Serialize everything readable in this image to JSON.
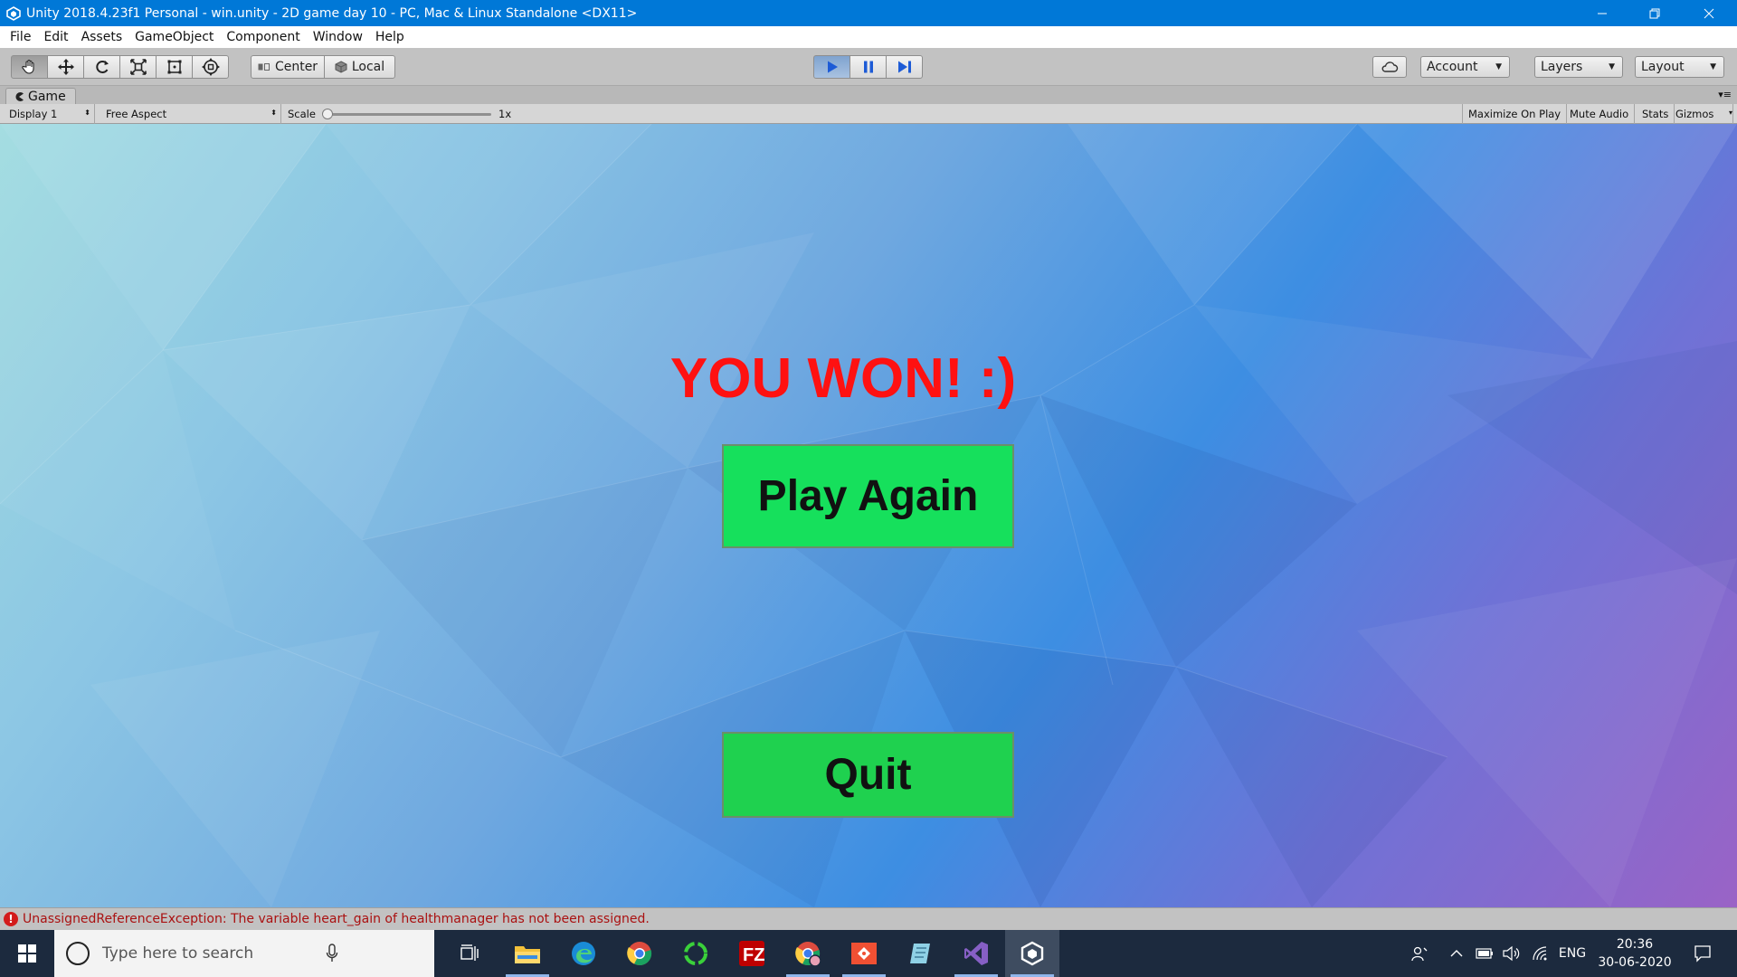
{
  "window": {
    "title": "Unity 2018.4.23f1 Personal - win.unity - 2D game day 10 - PC, Mac & Linux Standalone <DX11>",
    "controls": [
      "minimize-icon",
      "restore-icon",
      "close-icon"
    ]
  },
  "menu": {
    "items": [
      "File",
      "Edit",
      "Assets",
      "GameObject",
      "Component",
      "Window",
      "Help"
    ]
  },
  "toolbar": {
    "transform_tools": [
      "hand-icon",
      "move-icon",
      "rotate-icon",
      "scale-icon",
      "rect-tool-icon",
      "transform-tool-icon"
    ],
    "pivot_label": "Center",
    "space_label": "Local",
    "playback": [
      "play-icon",
      "pause-icon",
      "step-icon"
    ],
    "account_label": "Account",
    "layers_label": "Layers",
    "layout_label": "Layout",
    "accent_color": "#4a78b8"
  },
  "game_view": {
    "tab_label": "Game",
    "display_label": "Display 1",
    "aspect_label": "Free Aspect",
    "scale_label": "Scale",
    "scale_value": "1x",
    "maximize_label": "Maximize On Play",
    "mute_label": "Mute Audio",
    "stats_label": "Stats",
    "gizmos_label": "Gizmos"
  },
  "game": {
    "win_text": "YOU WON! :)",
    "win_color": "#ff1111",
    "play_again_label": "Play Again",
    "quit_label": "Quit",
    "button_color": "#16e05c"
  },
  "status": {
    "message": "UnassignedReferenceException: The variable heart_gain of healthmanager has not been assigned.",
    "error_color": "#d31b1b"
  },
  "taskbar": {
    "search_placeholder": "Type here to search",
    "apps": [
      "file-explorer-icon",
      "edge-icon",
      "chrome-icon",
      "refresh-app-icon",
      "filezilla-icon",
      "chrome-profile-icon",
      "git-icon",
      "notepad-icon",
      "visual-studio-icon",
      "unity-icon"
    ],
    "tray": {
      "language": "ENG",
      "time": "20:36",
      "date": "30-06-2020"
    }
  }
}
